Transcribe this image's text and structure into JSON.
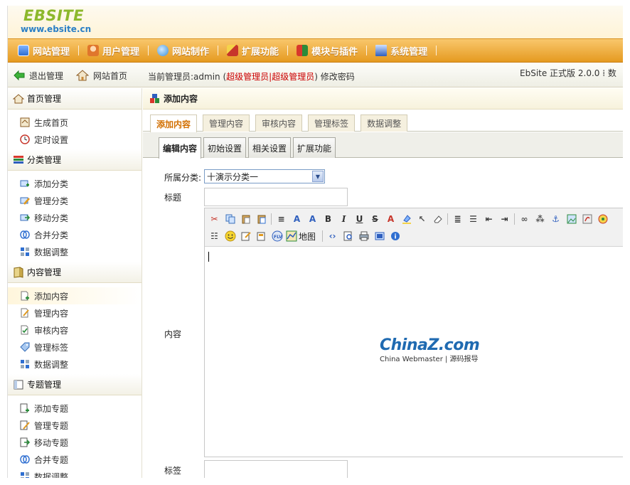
{
  "header": {
    "logo_text": "EBSITE",
    "logo_url": "www.ebsite.cn"
  },
  "topnav": [
    {
      "label": "网站管理",
      "icon": "site-icon",
      "color": "#2f6fd1"
    },
    {
      "label": "用户管理",
      "icon": "user-icon",
      "color": "#e0762c"
    },
    {
      "label": "网站制作",
      "icon": "globe-icon",
      "color": "#3a8fd8"
    },
    {
      "label": "扩展功能",
      "icon": "extension-icon",
      "color": "#c7362b"
    },
    {
      "label": "模块与插件",
      "icon": "blocks-icon",
      "color": "#2a8b3a"
    },
    {
      "label": "系统管理",
      "icon": "monitor-icon",
      "color": "#2f5fbe"
    }
  ],
  "toolbar": {
    "logout": "退出管理",
    "home": "网站首页",
    "admin_prefix": "当前管理员:admin (",
    "admin_role1": "超级管理员",
    "admin_sep": "|",
    "admin_role2": "超级管理员",
    "admin_suffix": ")",
    "change_password": "修改密码",
    "version": "EbSite 正式版  2.0.0  ⁞  数"
  },
  "sidebar": {
    "groups": [
      {
        "title": "首页管理",
        "items": [
          "生成首页",
          "定时设置"
        ]
      },
      {
        "title": "分类管理",
        "items": [
          "添加分类",
          "管理分类",
          "移动分类",
          "合并分类",
          "数据调整"
        ]
      },
      {
        "title": "内容管理",
        "items": [
          "添加内容",
          "管理内容",
          "审核内容",
          "管理标签",
          "数据调整"
        ]
      },
      {
        "title": "专题管理",
        "items": [
          "添加专题",
          "管理专题",
          "移动专题",
          "合并专题",
          "数据调整"
        ]
      }
    ]
  },
  "main": {
    "page_title": "添加内容",
    "tabs": [
      "添加内容",
      "管理内容",
      "审核内容",
      "管理标签",
      "数据调整"
    ],
    "subtabs": [
      "编辑内容",
      "初始设置",
      "相关设置",
      "扩展功能"
    ],
    "form": {
      "category_label": "所属分类:",
      "category_value": "十演示分类一",
      "title_label": "标题",
      "content_label": "内容",
      "tags_label": "标签",
      "map_button": "地图"
    },
    "watermark": {
      "main": "ChinaZ.com",
      "sub": "China Webmaster | 源码报导"
    }
  },
  "colors": {
    "nav_orange": "#e8a030",
    "active_tab": "#d26f00",
    "admin_red": "#cc0000",
    "logo_green": "#8cb82c",
    "logo_blue": "#2a7fc6"
  }
}
